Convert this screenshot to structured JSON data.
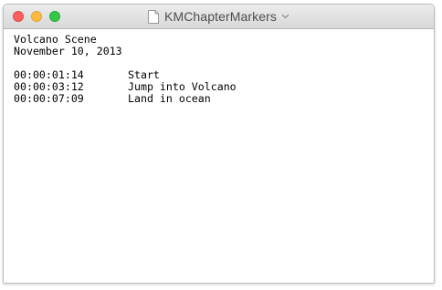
{
  "window": {
    "title": "KMChapterMarkers"
  },
  "document": {
    "title_line": "Volcano Scene",
    "date_line": "November 10, 2013",
    "markers": [
      {
        "timecode": "00:00:01:14",
        "label": "Start"
      },
      {
        "timecode": "00:00:03:12",
        "label": "Jump into Volcano"
      },
      {
        "timecode": "00:00:07:09",
        "label": "Land in ocean"
      }
    ]
  },
  "colors": {
    "close": "#fc605c",
    "minimize": "#fdbc40",
    "zoom": "#34c84a",
    "titlebar": "#e2e2e2"
  }
}
